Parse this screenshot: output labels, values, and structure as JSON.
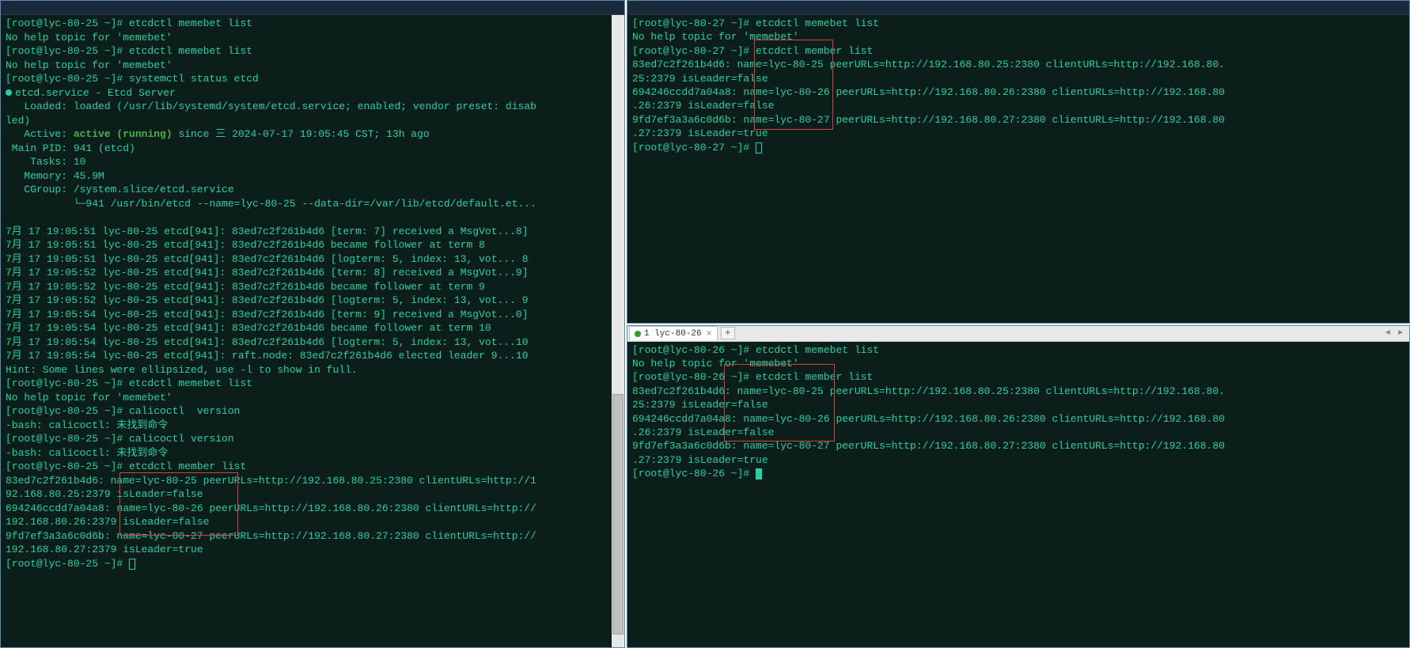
{
  "left": {
    "title_hint": "lyc-80-25",
    "prompt": "[root@lyc-80-25 ~]#",
    "lines": [
      {
        "t": "cmd",
        "v": "[root@lyc-80-25 ~]# etcdctl memebet list"
      },
      {
        "t": "out",
        "v": "No help topic for 'memebet'"
      },
      {
        "t": "cmd",
        "v": "[root@lyc-80-25 ~]# etcdctl memebet list"
      },
      {
        "t": "out",
        "v": "No help topic for 'memebet'"
      },
      {
        "t": "cmd",
        "v": "[root@lyc-80-25 ~]# systemctl status etcd"
      },
      {
        "t": "svc",
        "v": "etcd.service - Etcd Server"
      },
      {
        "t": "out",
        "v": "   Loaded: loaded (/usr/lib/systemd/system/etcd.service; enabled; vendor preset: disab"
      },
      {
        "t": "out",
        "v": "led)"
      },
      {
        "t": "active",
        "pre": "   Active: ",
        "state": "active (running)",
        "post": " since 三 2024-07-17 19:05:45 CST; 13h ago"
      },
      {
        "t": "out",
        "v": " Main PID: 941 (etcd)"
      },
      {
        "t": "out",
        "v": "    Tasks: 10"
      },
      {
        "t": "out",
        "v": "   Memory: 45.9M"
      },
      {
        "t": "out",
        "v": "   CGroup: /system.slice/etcd.service"
      },
      {
        "t": "out",
        "v": "           └─941 /usr/bin/etcd --name=lyc-80-25 --data-dir=/var/lib/etcd/default.et..."
      },
      {
        "t": "blank",
        "v": ""
      },
      {
        "t": "out",
        "v": "7月 17 19:05:51 lyc-80-25 etcd[941]: 83ed7c2f261b4d6 [term: 7] received a MsgVot...8]"
      },
      {
        "t": "out",
        "v": "7月 17 19:05:51 lyc-80-25 etcd[941]: 83ed7c2f261b4d6 became follower at term 8"
      },
      {
        "t": "out",
        "v": "7月 17 19:05:51 lyc-80-25 etcd[941]: 83ed7c2f261b4d6 [logterm: 5, index: 13, vot... 8"
      },
      {
        "t": "out",
        "v": "7月 17 19:05:52 lyc-80-25 etcd[941]: 83ed7c2f261b4d6 [term: 8] received a MsgVot...9]"
      },
      {
        "t": "out",
        "v": "7月 17 19:05:52 lyc-80-25 etcd[941]: 83ed7c2f261b4d6 became follower at term 9"
      },
      {
        "t": "out",
        "v": "7月 17 19:05:52 lyc-80-25 etcd[941]: 83ed7c2f261b4d6 [logterm: 5, index: 13, vot... 9"
      },
      {
        "t": "out",
        "v": "7月 17 19:05:54 lyc-80-25 etcd[941]: 83ed7c2f261b4d6 [term: 9] received a MsgVot...0]"
      },
      {
        "t": "out",
        "v": "7月 17 19:05:54 lyc-80-25 etcd[941]: 83ed7c2f261b4d6 became follower at term 10"
      },
      {
        "t": "out",
        "v": "7月 17 19:05:54 lyc-80-25 etcd[941]: 83ed7c2f261b4d6 [logterm: 5, index: 13, vot...10"
      },
      {
        "t": "out",
        "v": "7月 17 19:05:54 lyc-80-25 etcd[941]: raft.node: 83ed7c2f261b4d6 elected leader 9...10"
      },
      {
        "t": "out",
        "v": "Hint: Some lines were ellipsized, use -l to show in full."
      },
      {
        "t": "cmd",
        "v": "[root@lyc-80-25 ~]# etcdctl memebet list"
      },
      {
        "t": "out",
        "v": "No help topic for 'memebet'"
      },
      {
        "t": "cmd",
        "v": "[root@lyc-80-25 ~]# calicoctl  version"
      },
      {
        "t": "out",
        "v": "-bash: calicoctl: 未找到命令"
      },
      {
        "t": "cmd",
        "v": "[root@lyc-80-25 ~]# calicoctl version"
      },
      {
        "t": "out",
        "v": "-bash: calicoctl: 未找到命令"
      },
      {
        "t": "cmd",
        "v": "[root@lyc-80-25 ~]# etcdctl member list"
      },
      {
        "t": "out",
        "v": "83ed7c2f261b4d6: name=lyc-80-25 peerURLs=http://192.168.80.25:2380 clientURLs=http://1"
      },
      {
        "t": "out",
        "v": "92.168.80.25:2379 isLeader=false"
      },
      {
        "t": "out",
        "v": "694246ccdd7a04a8: name=lyc-80-26 peerURLs=http://192.168.80.26:2380 clientURLs=http://"
      },
      {
        "t": "out",
        "v": "192.168.80.26:2379 isLeader=false"
      },
      {
        "t": "out",
        "v": "9fd7ef3a3a6c0d6b: name=lyc-80-27 peerURLs=http://192.168.80.27:2380 clientURLs=http://"
      },
      {
        "t": "out",
        "v": "192.168.80.27:2379 isLeader=true"
      },
      {
        "t": "cursor",
        "v": "[root@lyc-80-25 ~]# "
      }
    ]
  },
  "top_right": {
    "title_hint": "lyc-80-27",
    "prompt": "[root@lyc-80-27 ~]#",
    "lines": [
      {
        "t": "cmd",
        "v": "[root@lyc-80-27 ~]# etcdctl memebet list"
      },
      {
        "t": "out",
        "v": "No help topic for 'memebet'"
      },
      {
        "t": "cmd",
        "v": "[root@lyc-80-27 ~]# etcdctl member list"
      },
      {
        "t": "out",
        "v": "83ed7c2f261b4d6: name=lyc-80-25 peerURLs=http://192.168.80.25:2380 clientURLs=http://192.168.80."
      },
      {
        "t": "out",
        "v": "25:2379 isLeader=false"
      },
      {
        "t": "out",
        "v": "694246ccdd7a04a8: name=lyc-80-26 peerURLs=http://192.168.80.26:2380 clientURLs=http://192.168.80"
      },
      {
        "t": "out",
        "v": ".26:2379 isLeader=false"
      },
      {
        "t": "out",
        "v": "9fd7ef3a3a6c0d6b: name=lyc-80-27 peerURLs=http://192.168.80.27:2380 clientURLs=http://192.168.80"
      },
      {
        "t": "out",
        "v": ".27:2379 isLeader=true"
      },
      {
        "t": "cursor",
        "v": "[root@lyc-80-27 ~]# "
      }
    ]
  },
  "bottom_right": {
    "tab_label": "1 lyc-80-26",
    "prompt": "[root@lyc-80-26 ~]#",
    "lines": [
      {
        "t": "cmd",
        "v": "[root@lyc-80-26 ~]# etcdctl memebet list"
      },
      {
        "t": "out",
        "v": "No help topic for 'memebet'"
      },
      {
        "t": "cmd",
        "v": "[root@lyc-80-26 ~]# etcdctl member list"
      },
      {
        "t": "out",
        "v": "83ed7c2f261b4d6: name=lyc-80-25 peerURLs=http://192.168.80.25:2380 clientURLs=http://192.168.80."
      },
      {
        "t": "out",
        "v": "25:2379 isLeader=false"
      },
      {
        "t": "out",
        "v": "694246ccdd7a04a8: name=lyc-80-26 peerURLs=http://192.168.80.26:2380 clientURLs=http://192.168.80"
      },
      {
        "t": "out",
        "v": ".26:2379 isLeader=false"
      },
      {
        "t": "out",
        "v": "9fd7ef3a3a6c0d6b: name=lyc-80-27 peerURLs=http://192.168.80.27:2380 clientURLs=http://192.168.80"
      },
      {
        "t": "out",
        "v": ".27:2379 isLeader=true"
      },
      {
        "t": "cursor-solid",
        "v": "[root@lyc-80-26 ~]# "
      }
    ]
  }
}
